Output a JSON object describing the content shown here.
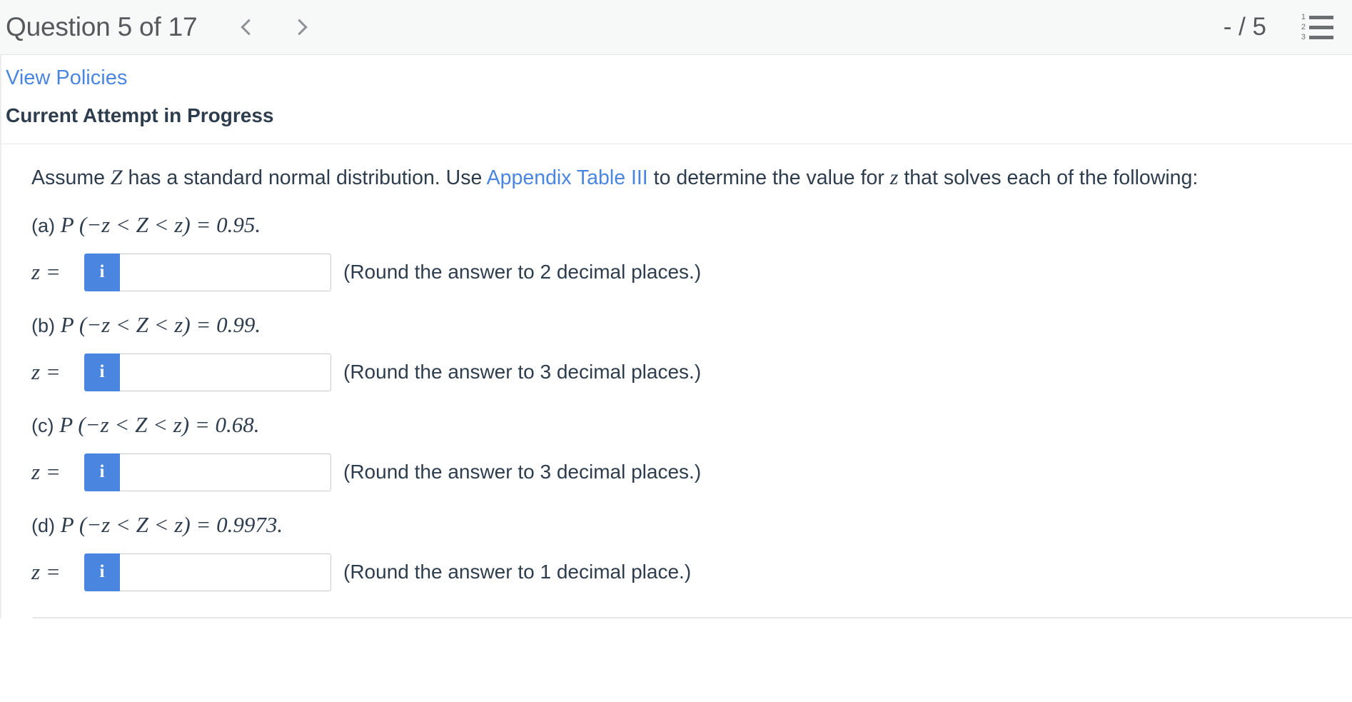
{
  "header": {
    "title": "Question 5 of 17",
    "prev_label": "‹",
    "next_label": "›",
    "score": "- / 5",
    "list_icon_numbers": [
      "1",
      "2",
      "3"
    ]
  },
  "top": {
    "view_policies": "View Policies",
    "attempt_status": "Current Attempt in Progress"
  },
  "prompt": {
    "before_var": "Assume ",
    "var": "Z",
    "after_var": " has a standard normal distribution. Use ",
    "link": "Appendix Table III",
    "middle": " to determine the value for ",
    "var2": "z",
    "tail": " that solves each of the following:"
  },
  "answer_prefix": "z =",
  "info_button_label": "i",
  "input_placeholder": "",
  "parts": [
    {
      "label": "(a)",
      "equation": "P (−z < Z < z) = 0.95.",
      "p": "P",
      "lhs": "(−z < Z < z)",
      "eq": "=",
      "value": "0.95.",
      "input_value": "",
      "hint": "(Round the answer to 2 decimal places.)"
    },
    {
      "label": "(b)",
      "equation": "P (−z < Z < z) = 0.99.",
      "p": "P",
      "lhs": "(−z < Z < z)",
      "eq": "=",
      "value": "0.99.",
      "input_value": "",
      "hint": "(Round the answer to 3 decimal places.)"
    },
    {
      "label": "(c)",
      "equation": "P (−z < Z < z) = 0.68.",
      "p": "P",
      "lhs": "(−z < Z < z)",
      "eq": "=",
      "value": "0.68.",
      "input_value": "",
      "hint": "(Round the answer to 3 decimal places.)"
    },
    {
      "label": "(d)",
      "equation": "P (−z < Z < z) = 0.9973.",
      "p": "P",
      "lhs": "(−z < Z < z)",
      "eq": "=",
      "value": "0.9973.",
      "input_value": "",
      "hint": "(Round the answer to 1 decimal place.)"
    }
  ],
  "colors": {
    "link_blue": "#4a86e0",
    "header_bg": "#f7f8f8",
    "text": "#2e3d4d",
    "muted": "#55595c"
  }
}
